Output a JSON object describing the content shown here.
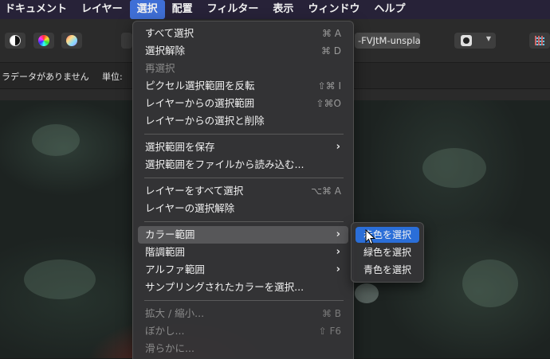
{
  "menubar": {
    "items": [
      {
        "label": "ドキュメント",
        "active": false
      },
      {
        "label": "レイヤー",
        "active": false
      },
      {
        "label": "選択",
        "active": true
      },
      {
        "label": "配置",
        "active": false
      },
      {
        "label": "フィルター",
        "active": false
      },
      {
        "label": "表示",
        "active": false
      },
      {
        "label": "ウィンドウ",
        "active": false
      },
      {
        "label": "ヘルプ",
        "active": false
      }
    ]
  },
  "toolbar": {
    "document_name": "-FVJtM-unspla"
  },
  "infobar": {
    "metadata_text": "ラデータがありません",
    "unit_label": "単位:"
  },
  "select_menu": {
    "items": [
      {
        "label": "すべて選択",
        "shortcut": "⌘ A"
      },
      {
        "label": "選択解除",
        "shortcut": "⌘ D"
      },
      {
        "label": "再選択",
        "shortcut": ""
      },
      {
        "label": "ピクセル選択範囲を反転",
        "shortcut": "⇧⌘ I"
      },
      {
        "label": "レイヤーからの選択範囲",
        "shortcut": "⇧⌘O"
      },
      {
        "label": "レイヤーからの選択と削除",
        "shortcut": ""
      },
      {
        "label": "選択範囲を保存",
        "shortcut": ""
      },
      {
        "label": "選択範囲をファイルから読み込む...",
        "shortcut": ""
      },
      {
        "label": "レイヤーをすべて選択",
        "shortcut": "⌥⌘ A"
      },
      {
        "label": "レイヤーの選択解除",
        "shortcut": ""
      },
      {
        "label": "カラー範囲",
        "shortcut": ""
      },
      {
        "label": "階調範囲",
        "shortcut": ""
      },
      {
        "label": "アルファ範囲",
        "shortcut": ""
      },
      {
        "label": "サンプリングされたカラーを選択...",
        "shortcut": ""
      },
      {
        "label": "拡大 / 縮小...",
        "shortcut": "⌘ B"
      },
      {
        "label": "ぼかし...",
        "shortcut": "⇧ F6"
      },
      {
        "label": "滑らかに...",
        "shortcut": ""
      }
    ]
  },
  "color_range_submenu": {
    "items": [
      {
        "label": "赤色を選択"
      },
      {
        "label": "緑色を選択"
      },
      {
        "label": "青色を選択"
      }
    ]
  },
  "colors": {
    "menubar_bg": "#272238",
    "active_menu": "#3f6fd6",
    "submenu_selection": "#2a6ed8",
    "menu_bg": "#343436"
  }
}
